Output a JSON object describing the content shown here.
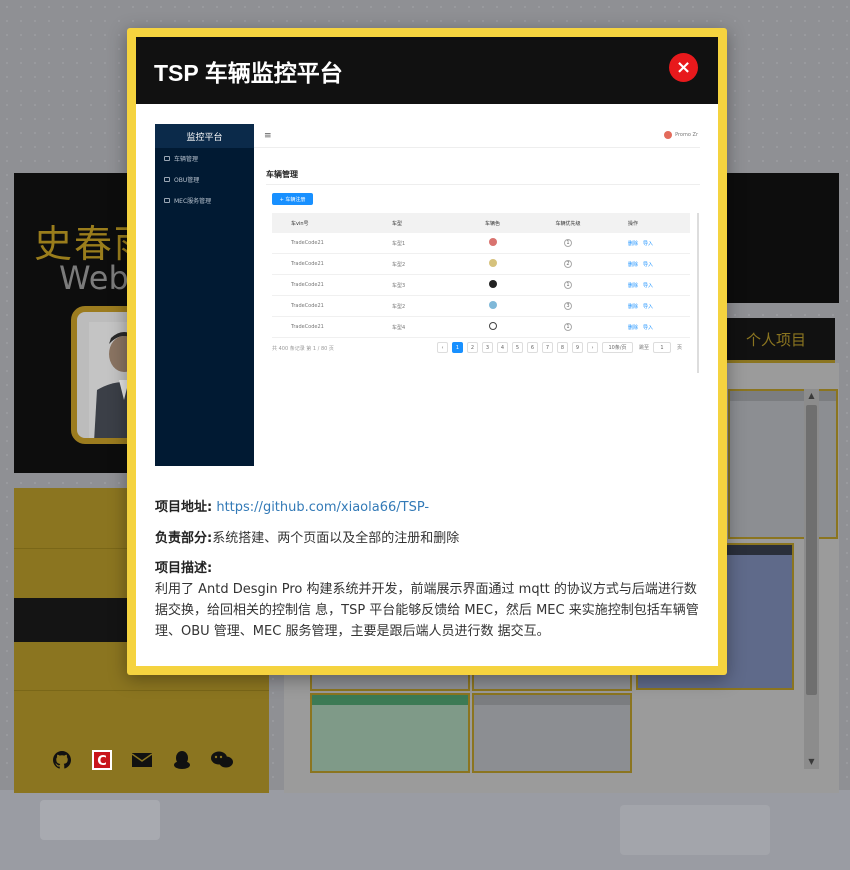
{
  "background": {
    "name_title": "史春雨",
    "name_subtitle": "Web 前",
    "tab_personal_projects": "个人项目"
  },
  "modal": {
    "title": "TSP 车辆监控平台",
    "close_symbol": "×",
    "screenshot": {
      "sider_title": "监控平台",
      "menu": [
        "车辆管理",
        "OBU管理",
        "MEC服务管理"
      ],
      "user_label": "Promo Zr",
      "page_heading": "车辆管理",
      "add_button": "+ 车辆注册",
      "columns": [
        "车vin号",
        "车型",
        "车辆色",
        "车辆优先级",
        "操作"
      ],
      "rows": [
        {
          "vin": "TradeCode21",
          "model": "车型1",
          "color": "#d9736f",
          "priority": "1"
        },
        {
          "vin": "TradeCode21",
          "model": "车型2",
          "color": "#d6c27c",
          "priority": "2"
        },
        {
          "vin": "TradeCode21",
          "model": "车型3",
          "color": "#222222",
          "priority": "1"
        },
        {
          "vin": "TradeCode21",
          "model": "车型2",
          "color": "#7fb8d8",
          "priority": "3"
        },
        {
          "vin": "TradeCode21",
          "model": "车型4",
          "color": "#ffffff",
          "priority": "1"
        }
      ],
      "action_delete": "删除",
      "action_import": "导入",
      "pager_total": "共 400 条记录 第 1 / 80 页",
      "pages": [
        "1",
        "2",
        "3",
        "4",
        "5",
        "6",
        "7",
        "8",
        "9"
      ],
      "page_size": "10条/页",
      "jump_label": "跳至",
      "jump_value": "1",
      "jump_unit": "页"
    },
    "address_label": "项目地址:",
    "address_link": "https://github.com/xiaola66/TSP-",
    "role_label": "负责部分:",
    "role_text": "系统搭建、两个页面以及全部的注册和删除",
    "desc_label": "项目描述:",
    "desc_text": "利用了 Antd Desgin Pro 构建系统并开发，前端展示界面通过 mqtt 的协议方式与后端进行数据交换，给回相关的控制信 息，TSP 平台能够反馈给 MEC，然后 MEC 来实施控制包括车辆管理、OBU 管理、MEC 服务管理，主要是跟后端人员进行数 据交互。"
  },
  "colors": {
    "modal_border": "#f5d33f",
    "modal_header": "#111111",
    "close_button": "#e8191c",
    "link": "#337ab7",
    "accent_gold": "#8b7520",
    "antd_primary": "#1890ff"
  },
  "icons": {
    "social": [
      "github-icon",
      "csdn-icon",
      "mail-icon",
      "qq-icon",
      "wechat-icon"
    ]
  }
}
